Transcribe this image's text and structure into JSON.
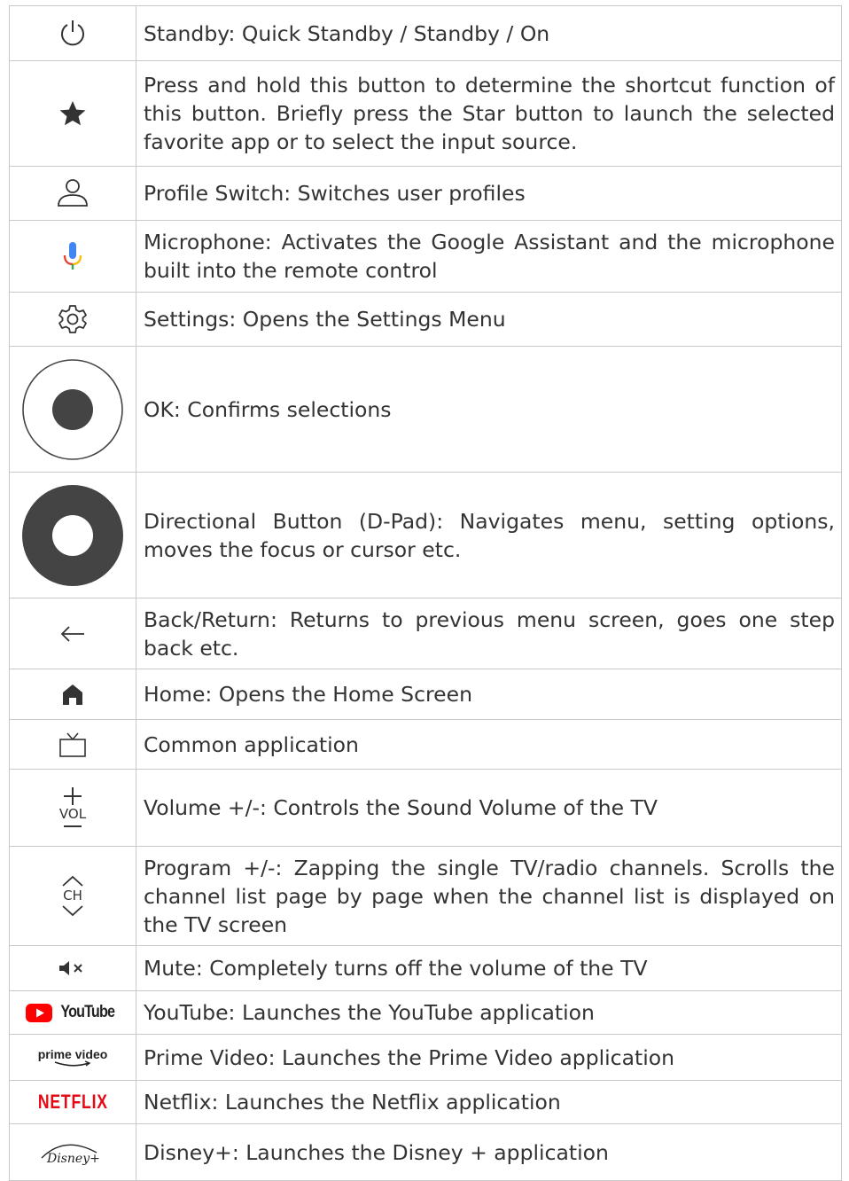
{
  "colors": {
    "border": "#c9c9c9",
    "icon": "#333333",
    "mic_blue": "#4285f4",
    "mic_red": "#ea4335",
    "mic_yellow": "#fbbc05",
    "mic_green": "#34a853",
    "youtube_red": "#ff0000",
    "netflix_red": "#e50914"
  },
  "rows": [
    {
      "icon": "power-icon",
      "text": "Standby: Quick Standby / Standby / On"
    },
    {
      "icon": "star-icon",
      "text": "Press and hold this button to determine the shortcut function of this button. Briefly press the Star button to launch the selected favorite app or to select the input source."
    },
    {
      "icon": "profile-icon",
      "text": "Profile Switch: Switches user profiles"
    },
    {
      "icon": "microphone-icon",
      "text": "Microphone: Activates the Google Assistant and the microphone built into the remote control"
    },
    {
      "icon": "gear-icon",
      "text": "Settings: Opens the Settings Menu"
    },
    {
      "icon": "ok-button-icon",
      "text": "OK: Confirms selections"
    },
    {
      "icon": "dpad-icon",
      "text": "Directional Button (D-Pad): Navigates menu, setting options, moves the focus or cursor etc."
    },
    {
      "icon": "back-arrow-icon",
      "text": "Back/Return: Returns to previous menu screen, goes one step back etc."
    },
    {
      "icon": "home-icon",
      "text": "Home: Opens the Home Screen"
    },
    {
      "icon": "tv-icon",
      "text": "Common application"
    },
    {
      "icon": "volume-icon",
      "icon_label": "VOL",
      "text": "Volume +/-: Controls the Sound Volume of the TV"
    },
    {
      "icon": "channel-icon",
      "icon_label": "CH",
      "text": "Program +/-: Zapping the single TV/radio channels. Scrolls the channel list page by page when the channel list is displayed on the TV screen"
    },
    {
      "icon": "mute-icon",
      "text": "Mute: Completely turns off the volume of the TV"
    },
    {
      "icon": "youtube-logo-icon",
      "icon_label": "YouTube",
      "text": "YouTube: Launches the YouTube application"
    },
    {
      "icon": "prime-video-logo-icon",
      "icon_label": "prime video",
      "text": "Prime Video: Launches the Prime Video application"
    },
    {
      "icon": "netflix-logo-icon",
      "icon_label": "NETFLIX",
      "text": "Netflix: Launches the Netflix application"
    },
    {
      "icon": "disney-plus-logo-icon",
      "icon_label": "Disney+",
      "text": "Disney+: Launches the Disney + application"
    }
  ]
}
